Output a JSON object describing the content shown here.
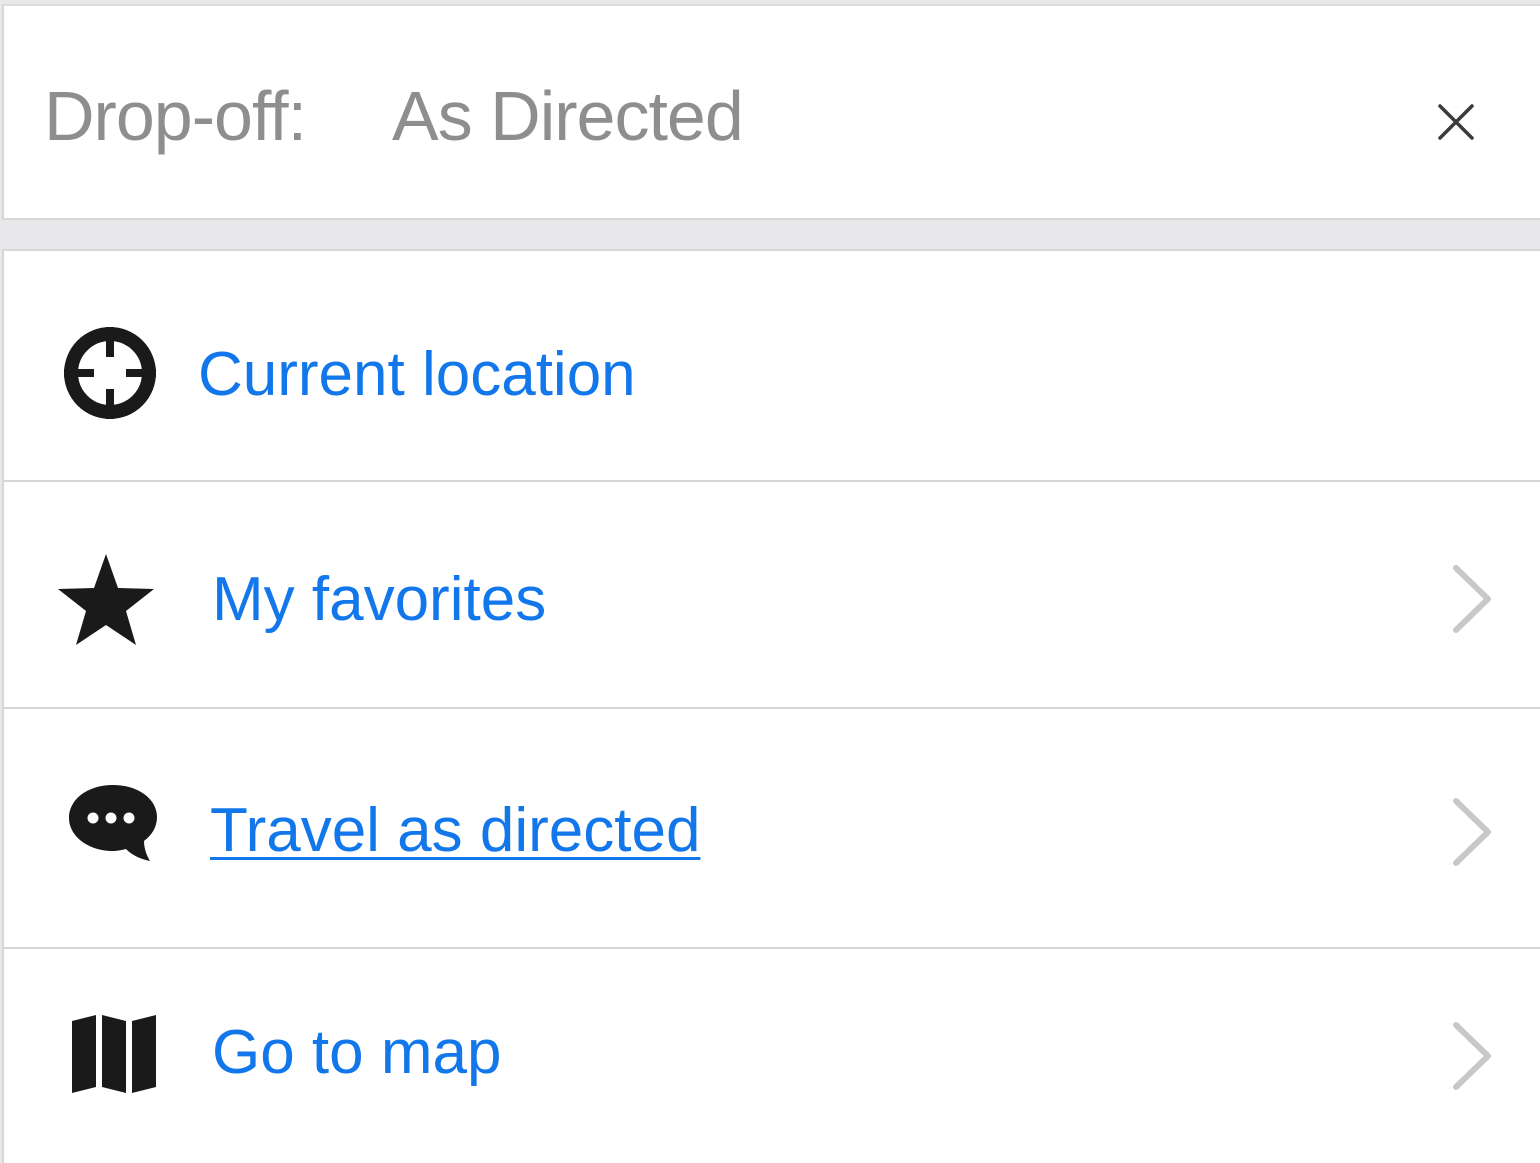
{
  "header": {
    "label": "Drop-off:",
    "value": "As Directed",
    "close_icon": "close-icon"
  },
  "list": {
    "items": [
      {
        "label": "Current location",
        "icon": "crosshair-icon",
        "has_chevron": false,
        "underlined": false
      },
      {
        "label": "My favorites",
        "icon": "star-icon",
        "has_chevron": true,
        "underlined": false
      },
      {
        "label": "Travel as directed",
        "icon": "chat-bubble-icon",
        "has_chevron": true,
        "underlined": true
      },
      {
        "label": "Go to map",
        "icon": "map-icon",
        "has_chevron": true,
        "underlined": false
      }
    ]
  },
  "colors": {
    "link": "#1277ea",
    "muted_text": "#8e8e8e",
    "icon": "#1a1a1a",
    "chevron": "#c8c8c8",
    "divider": "#d6d6d6",
    "background": "#e8e8ea"
  }
}
